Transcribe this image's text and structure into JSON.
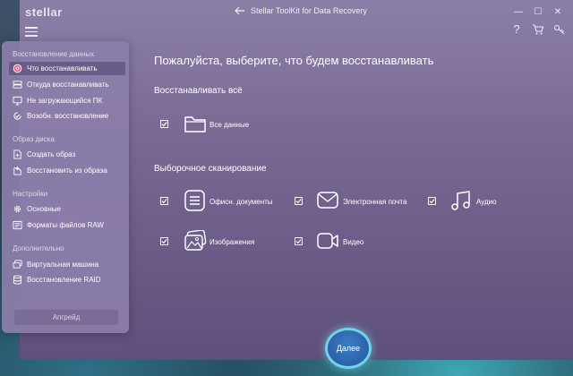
{
  "app": {
    "brand": "stellar",
    "title": "Stellar ToolKit for Data Recovery"
  },
  "window_controls": {
    "minimize": "—",
    "maximize": "☐",
    "close": "✕"
  },
  "toolbar": {
    "help_glyph": "?"
  },
  "sidebar": {
    "sections": [
      {
        "title": "Восстановление данных",
        "items": [
          {
            "label": "Что восстанавливать",
            "icon": "target-icon",
            "active": true
          },
          {
            "label": "Откуда восстанавливать",
            "icon": "drive-icon"
          },
          {
            "label": "Не загружающийся ПК",
            "icon": "monitor-icon"
          },
          {
            "label": "Возобн. восстановление",
            "icon": "resume-icon"
          }
        ]
      },
      {
        "title": "Образ диска",
        "items": [
          {
            "label": "Создать образ",
            "icon": "create-image-icon"
          },
          {
            "label": "Восстановить из образа",
            "icon": "restore-image-icon"
          }
        ]
      },
      {
        "title": "Настройки",
        "items": [
          {
            "label": "Основные",
            "icon": "gear-icon"
          },
          {
            "label": "Форматы файлов RAW",
            "icon": "raw-formats-icon"
          }
        ]
      },
      {
        "title": "Дополнительно",
        "items": [
          {
            "label": "Виртуальная машина",
            "icon": "virtual-machine-icon"
          },
          {
            "label": "Восстановление RAID",
            "icon": "raid-icon"
          }
        ]
      }
    ],
    "upgrade_label": "Апгрейд"
  },
  "main": {
    "heading": "Пожалуйста, выберите, что будем восстанавливать",
    "restore_all_heading": "Восстанавливать всё",
    "all_data_label": "Все данные",
    "selective_heading": "Выборочное сканирование",
    "options": [
      {
        "label": "Офисн. документы",
        "icon": "document-icon",
        "checked": true
      },
      {
        "label": "Электронная почта",
        "icon": "email-icon",
        "checked": true
      },
      {
        "label": "Аудио",
        "icon": "music-icon",
        "checked": true
      },
      {
        "label": "Изображения",
        "icon": "image-icon",
        "checked": true
      },
      {
        "label": "Видео",
        "icon": "video-icon",
        "checked": true
      }
    ],
    "next_label": "Далее"
  },
  "colors": {
    "accent_ring": "#6fd3ea",
    "next_button": "#2b62a8",
    "window_top": "#8b7fa7",
    "window_bottom": "#5e4f7c",
    "active_target": "#e8457a"
  }
}
